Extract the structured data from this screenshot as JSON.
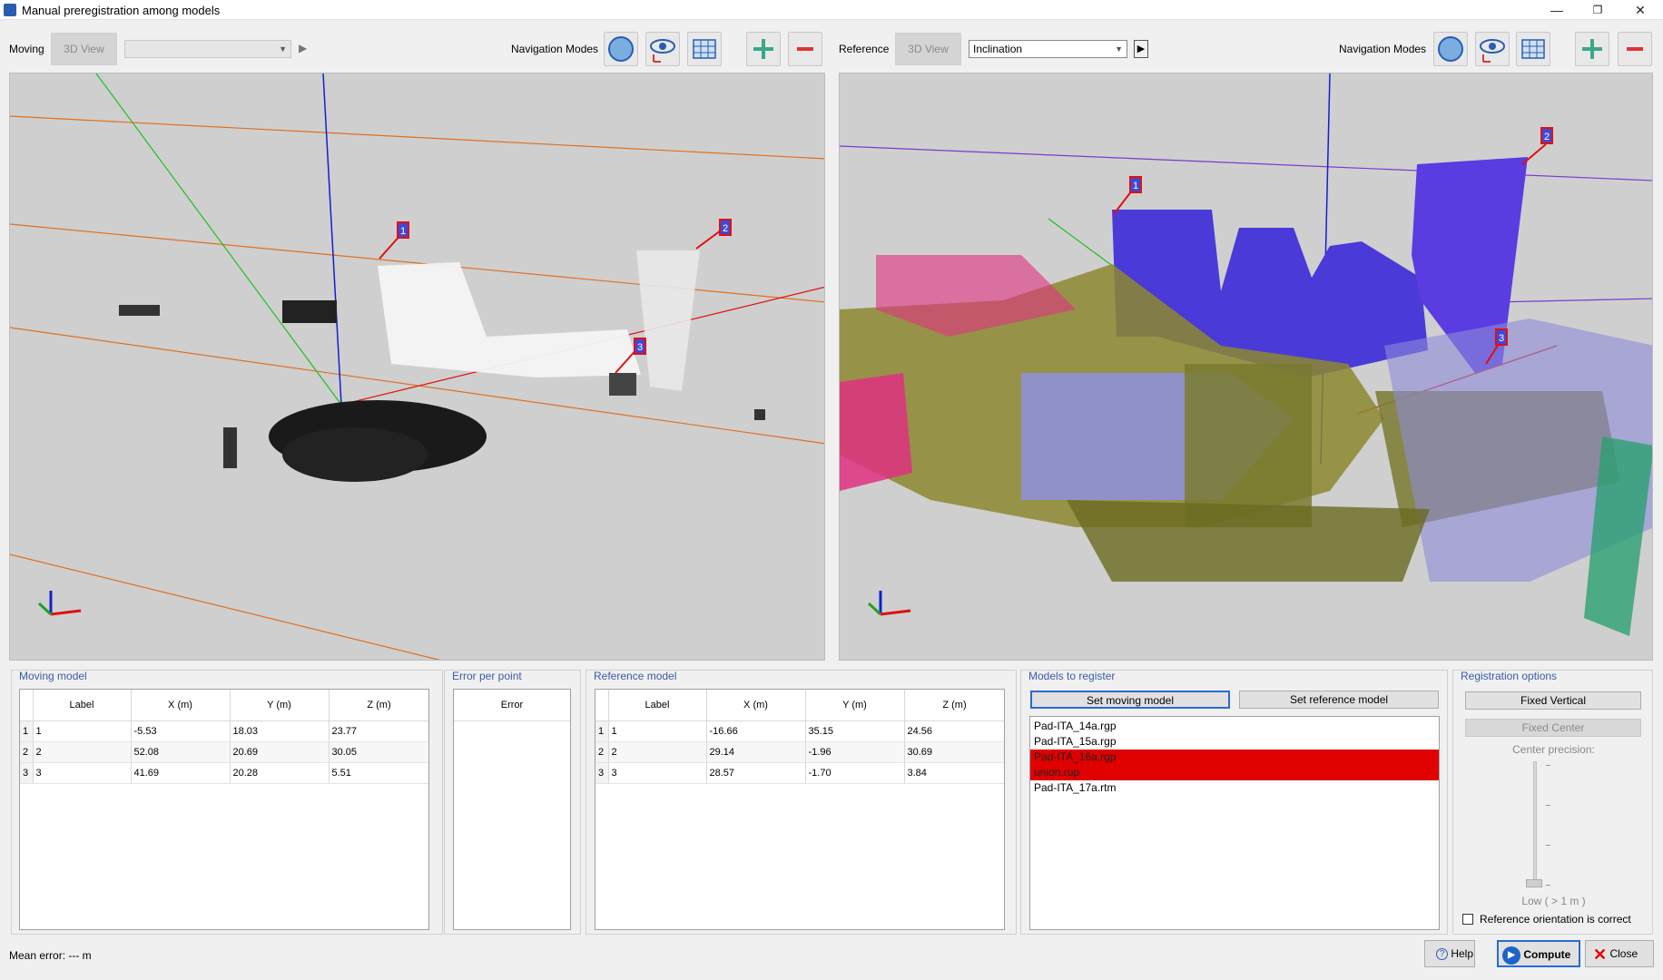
{
  "window": {
    "title": "Manual preregistration among models"
  },
  "moving_bar": {
    "label": "Moving",
    "view_button": "3D View",
    "dropdown_value": "",
    "nav_label": "Navigation Modes"
  },
  "reference_bar": {
    "label": "Reference",
    "view_button": "3D View",
    "dropdown_value": "Inclination",
    "nav_label": "Navigation Modes"
  },
  "moving_view": {
    "markers": [
      "1",
      "2",
      "3"
    ]
  },
  "reference_view": {
    "markers": [
      "1",
      "2",
      "3"
    ]
  },
  "moving_model": {
    "title": "Moving model",
    "columns": [
      "Label",
      "X (m)",
      "Y (m)",
      "Z (m)"
    ],
    "rows": [
      {
        "n": "1",
        "label": "1",
        "x": "-5.53",
        "y": "18.03",
        "z": "23.77"
      },
      {
        "n": "2",
        "label": "2",
        "x": "52.08",
        "y": "20.69",
        "z": "30.05"
      },
      {
        "n": "3",
        "label": "3",
        "x": "41.69",
        "y": "20.28",
        "z": "5.51"
      }
    ]
  },
  "error_panel": {
    "title": "Error per point",
    "column": "Error"
  },
  "reference_model": {
    "title": "Reference model",
    "columns": [
      "Label",
      "X (m)",
      "Y (m)",
      "Z (m)"
    ],
    "rows": [
      {
        "n": "1",
        "label": "1",
        "x": "-16.66",
        "y": "35.15",
        "z": "24.56"
      },
      {
        "n": "2",
        "label": "2",
        "x": "29.14",
        "y": "-1.96",
        "z": "30.69"
      },
      {
        "n": "3",
        "label": "3",
        "x": "28.57",
        "y": "-1.70",
        "z": "3.84"
      }
    ]
  },
  "models_to_register": {
    "title": "Models to register",
    "set_moving": "Set moving model",
    "set_reference": "Set reference model",
    "items": [
      "Pad-ITA_14a.rgp",
      "Pad-ITA_15a.rgp",
      "Pad-ITA_16a.rgp",
      "union.rup",
      "Pad-ITA_17a.rtm"
    ],
    "selected": [
      2,
      3
    ]
  },
  "registration_options": {
    "title": "Registration options",
    "fixed_vertical": "Fixed  Vertical",
    "fixed_center": "Fixed Center",
    "center_precision_label": "Center precision:",
    "precision_value": "Low ( > 1 m )",
    "checkbox_label": "Reference orientation is correct"
  },
  "footer": {
    "mean_error": "Mean error: --- m",
    "help": "Help",
    "compute": "Compute",
    "close": "Close"
  }
}
